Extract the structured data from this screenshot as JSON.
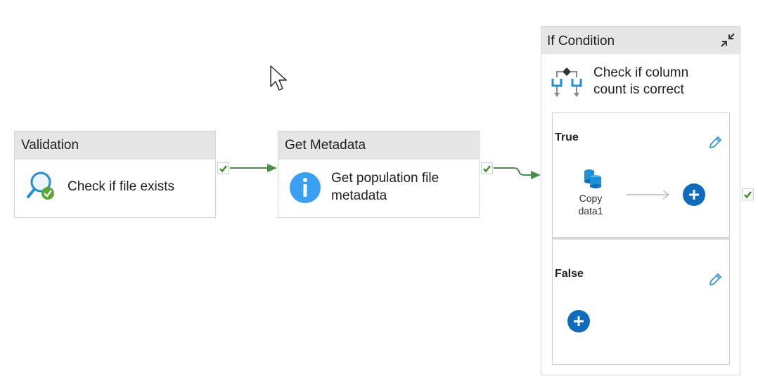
{
  "activities": {
    "validation": {
      "title": "Validation",
      "description": "Check if file exists"
    },
    "get_metadata": {
      "title": "Get Metadata",
      "description_line1": "Get population file",
      "description_line2": "metadata"
    },
    "if_condition": {
      "title": "If Condition",
      "description_line1": "Check if column",
      "description_line2": "count is correct",
      "true_branch": {
        "label": "True",
        "activity": {
          "name_line1": "Copy",
          "name_line2": "data1",
          "icon": "copy-data-icon"
        }
      },
      "false_branch": {
        "label": "False"
      }
    }
  },
  "icons": {
    "validation": "magnifier-check-icon",
    "get_metadata": "info-icon",
    "if_condition": "branch-icon",
    "collapse": "collapse-icon",
    "edit": "pencil-icon",
    "add": "plus-circle-icon"
  },
  "colors": {
    "success_green": "#3a8a1f",
    "connector_green": "#4c8c4a",
    "accent_blue": "#0f6cbd",
    "info_blue": "#3aa0f3",
    "header_gray": "#e6e6e6"
  }
}
